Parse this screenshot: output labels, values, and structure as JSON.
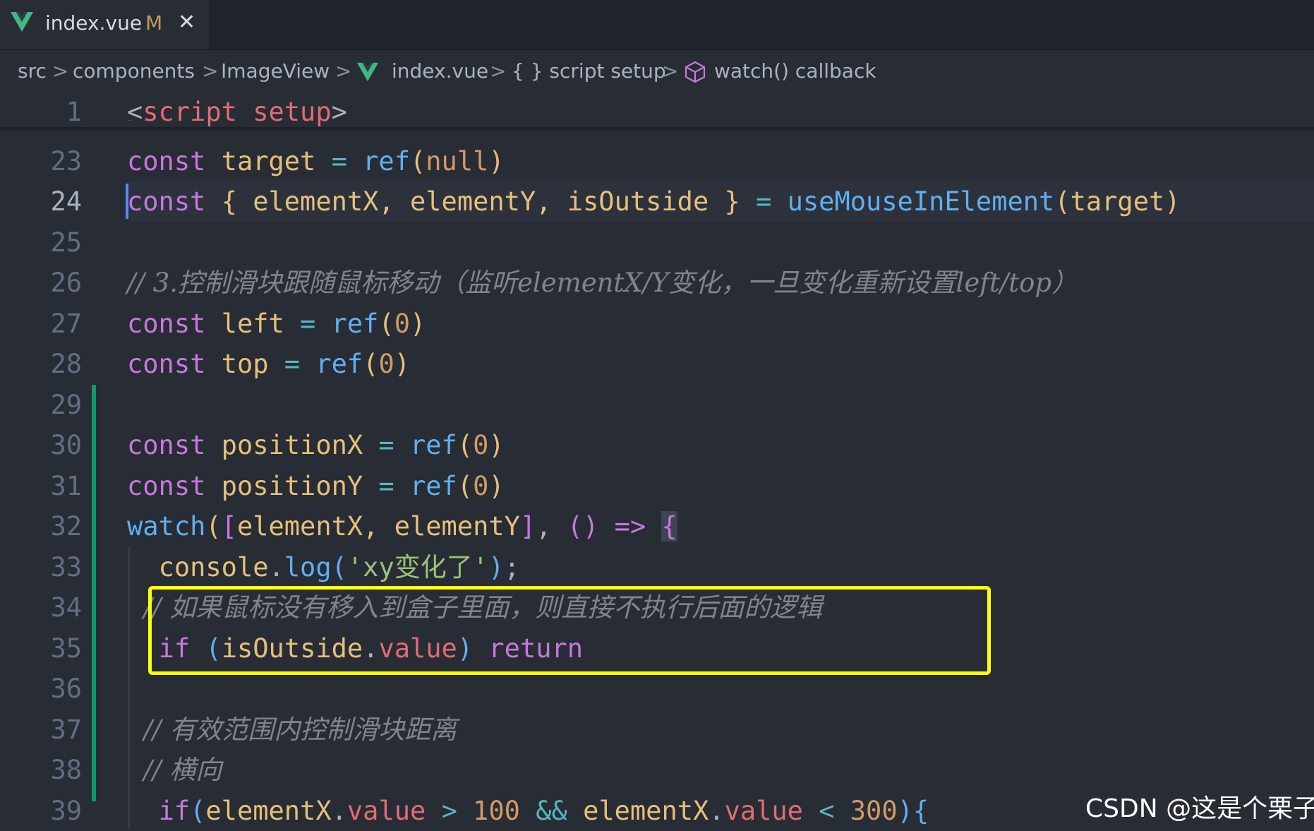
{
  "tab": {
    "filename": "index.vue",
    "modified": "M",
    "close": "✕"
  },
  "breadcrumb": {
    "items": [
      "src",
      "components",
      "ImageView",
      "index.vue",
      "{ } script setup",
      "watch() callback"
    ],
    "separator": ">"
  },
  "editor": {
    "active_line": 24,
    "line_numbers": [
      "1",
      "23",
      "24",
      "25",
      "26",
      "27",
      "28",
      "29",
      "30",
      "31",
      "32",
      "33",
      "34",
      "35",
      "36",
      "37",
      "38",
      "39"
    ],
    "lines": {
      "l1": {
        "t1": "<",
        "t2": "script",
        "t3": " ",
        "t4": "setup",
        "t5": ">"
      },
      "l23": {
        "t1": "const",
        "t2": " ",
        "t3": "target",
        "t4": " = ",
        "t5": "ref",
        "t6": "(",
        "t7": "null",
        "t8": ")"
      },
      "l24": {
        "t1": "const",
        "t2": " ",
        "t3": "{",
        "t4": " elementX, elementY, isOutside ",
        "t5": "}",
        "t6": " = ",
        "t7": "useMouseInElement",
        "t8": "(",
        "t9": "target",
        "t10": ")"
      },
      "l26": {
        "t1": "// 3.控制滑块跟随鼠标移动（监听elementX/Y变化，一旦变化重新设置left/top）"
      },
      "l27": {
        "t1": "const",
        "t2": " ",
        "t3": "left",
        "t4": " = ",
        "t5": "ref",
        "t6": "(",
        "t7": "0",
        "t8": ")"
      },
      "l28": {
        "t1": "const",
        "t2": " ",
        "t3": "top",
        "t4": " = ",
        "t5": "ref",
        "t6": "(",
        "t7": "0",
        "t8": ")"
      },
      "l30": {
        "t1": "const",
        "t2": " ",
        "t3": "positionX",
        "t4": " = ",
        "t5": "ref",
        "t6": "(",
        "t7": "0",
        "t8": ")"
      },
      "l31": {
        "t1": "const",
        "t2": " ",
        "t3": "positionY",
        "t4": " = ",
        "t5": "ref",
        "t6": "(",
        "t7": "0",
        "t8": ")"
      },
      "l32": {
        "t1": "watch",
        "t2": "(",
        "t3": "[",
        "t4": "elementX, elementY",
        "t5": "]",
        "t6": ", ",
        "t7": "()",
        "t8": " ",
        "t9": "=>",
        "t10": " ",
        "t11": "{"
      },
      "l33": {
        "t1": "  ",
        "t2": "console",
        "t3": ".",
        "t4": "log",
        "t5": "(",
        "t6": "'xy变化了'",
        "t7": ")",
        "t8": ";"
      },
      "l34": {
        "t1": "  // 如果鼠标没有移入到盒子里面，则直接不执行后面的逻辑"
      },
      "l35": {
        "t1": "  ",
        "t2": "if",
        "t3": " (",
        "t4": "isOutside",
        "t5": ".",
        "t6": "value",
        "t7": ")",
        "t8": " ",
        "t9": "return"
      },
      "l37": {
        "t1": "  // 有效范围内控制滑块距离"
      },
      "l38": {
        "t1": "  // 横向"
      },
      "l39": {
        "t1": "  ",
        "t2": "if",
        "t3": "(",
        "t4": "elementX",
        "t5": ".",
        "t6": "value",
        "t7": " > ",
        "t8": "100",
        "t9": " && ",
        "t10": "elementX",
        "t11": ".",
        "t12": "value",
        "t13": " < ",
        "t14": "300",
        "t15": ")",
        "t16": "{"
      }
    }
  },
  "watermark": "CSDN @这是个栗子",
  "colors": {
    "background": "#282c34",
    "keyword": "#c678dd",
    "variable": "#e5c07b",
    "function": "#61afef",
    "string": "#98c379",
    "number": "#d19a66",
    "property": "#e06c75",
    "comment": "#7f848e",
    "highlight_box": "#ffff00",
    "git_added": "#109868"
  },
  "icons": [
    "vue-icon",
    "chevron-right-icon",
    "braces-icon",
    "cube-icon",
    "close-icon"
  ]
}
